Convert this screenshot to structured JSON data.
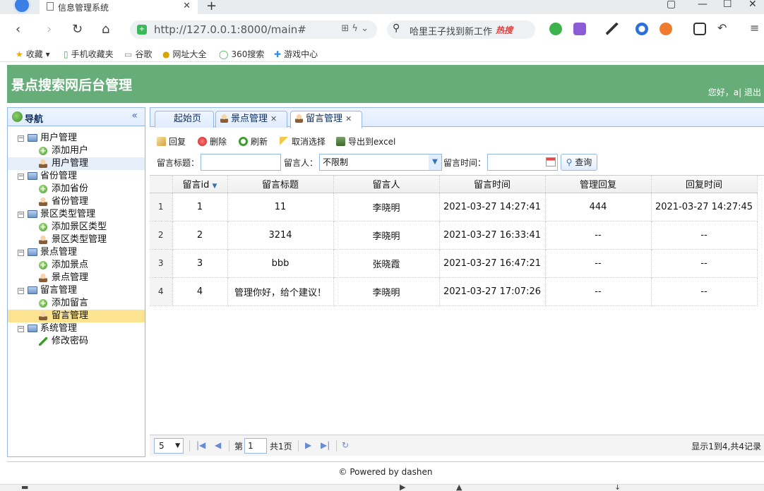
{
  "browser": {
    "tab_title": "信息管理系统",
    "url": "http://127.0.0.1:8000/main#",
    "search_hint": "哈里王子找到新工作",
    "search_hot": "热搜",
    "bookmarks": [
      "收藏",
      "手机收藏夹",
      "谷歌",
      "网址大全",
      "360搜索",
      "游戏中心"
    ]
  },
  "header": {
    "title": "景点搜索网后台管理",
    "greeting": "您好，",
    "username": "a",
    "separator": "|",
    "logout": "退出"
  },
  "sidebar": {
    "title": "导航",
    "groups": [
      {
        "label": "用户管理",
        "items": [
          "添加用户",
          "用户管理"
        ]
      },
      {
        "label": "省份管理",
        "items": [
          "添加省份",
          "省份管理"
        ]
      },
      {
        "label": "景区类型管理",
        "items": [
          "添加景区类型",
          "景区类型管理"
        ]
      },
      {
        "label": "景点管理",
        "items": [
          "添加景点",
          "景点管理"
        ]
      },
      {
        "label": "留言管理",
        "items": [
          "添加留言",
          "留言管理"
        ]
      },
      {
        "label": "系统管理",
        "items": [
          "修改密码"
        ]
      }
    ]
  },
  "tabs": [
    "起始页",
    "景点管理",
    "留言管理"
  ],
  "toolbar": {
    "reply": "回复",
    "delete": "删除",
    "refresh": "刷新",
    "unselect": "取消选择",
    "export": "导出到excel"
  },
  "filter": {
    "title_label": "留言标题：",
    "title_value": "",
    "person_label": "留言人：",
    "person_value": "不限制",
    "time_label": "留言时间：",
    "time_value": "",
    "query": "查询"
  },
  "grid": {
    "columns": [
      "留言id",
      "留言标题",
      "留言人",
      "留言时间",
      "管理回复",
      "回复时间"
    ],
    "rows": [
      {
        "rn": "1",
        "id": "1",
        "title": "11",
        "person": "李晓明",
        "time": "2021-03-27 14:27:41",
        "reply": "444",
        "reply_time": "2021-03-27 14:27:45"
      },
      {
        "rn": "2",
        "id": "2",
        "title": "3214",
        "person": "李晓明",
        "time": "2021-03-27 16:33:41",
        "reply": "--",
        "reply_time": "--"
      },
      {
        "rn": "3",
        "id": "3",
        "title": "bbb",
        "person": "张晓霞",
        "time": "2021-03-27 16:47:21",
        "reply": "--",
        "reply_time": "--"
      },
      {
        "rn": "4",
        "id": "4",
        "title": "管理你好，给个建议！",
        "person": "李晓明",
        "time": "2021-03-27 17:07:26",
        "reply": "--",
        "reply_time": "--"
      }
    ]
  },
  "pager": {
    "page_size": "5",
    "page_prefix": "第",
    "page_value": "1",
    "page_suffix": "共1页",
    "summary": "显示1到4,共4记录"
  },
  "footer": "© Powered by dashen"
}
